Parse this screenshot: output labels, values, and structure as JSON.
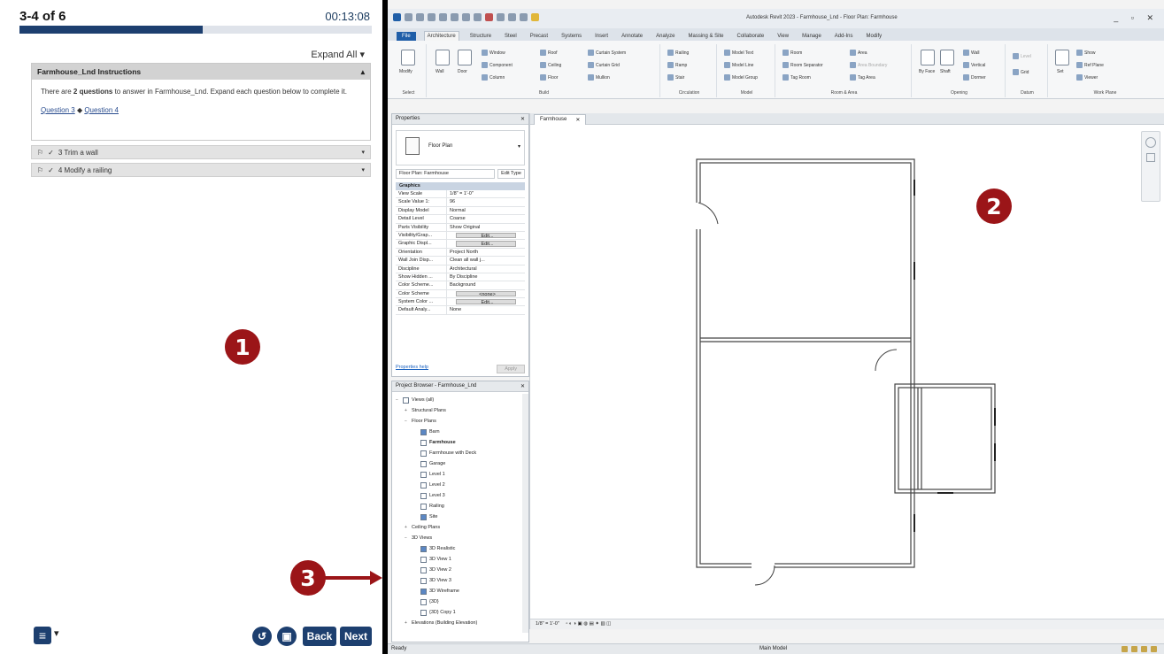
{
  "exam": {
    "question_count": "3-4 of 6",
    "timer": "00:13:08",
    "progress_fraction": 0.52,
    "expand_all": "Expand All",
    "instructions_title": "Farmhouse_Lnd Instructions",
    "instructions_body_pre": "There are ",
    "instructions_body_bold": "2 questions",
    "instructions_body_post": " to answer in Farmhouse_Lnd. Expand each question below to complete it.",
    "link_q3": "Question 3",
    "link_q4": "Question 4",
    "questions": [
      {
        "label": "3 Trim a wall"
      },
      {
        "label": "4 Modify a railing"
      }
    ],
    "back_label": "Back",
    "next_label": "Next",
    "markers": [
      "1",
      "2",
      "3"
    ],
    "marker_color": "#9b1518",
    "accent": "#1d3f6f"
  },
  "revit": {
    "title": "Autodesk Revit 2023 - Farmhouse_Lnd - Floor Plan: Farmhouse",
    "tabs": [
      "File",
      "Architecture",
      "Structure",
      "Steel",
      "Precast",
      "Systems",
      "Insert",
      "Annotate",
      "Analyze",
      "Massing & Site",
      "Collaborate",
      "View",
      "Manage",
      "Add-Ins",
      "Modify"
    ],
    "ribbon_groups": [
      {
        "label": "Select",
        "items": [
          "Modify"
        ]
      },
      {
        "label": "Build",
        "items": [
          "Wall",
          "Door",
          "Window",
          "Component",
          "Column",
          "Roof",
          "Ceiling",
          "Floor",
          "Curtain System",
          "Curtain Grid",
          "Mullion"
        ]
      },
      {
        "label": "Circulation",
        "items": [
          "Railing",
          "Ramp",
          "Stair"
        ]
      },
      {
        "label": "Model",
        "items": [
          "Model Text",
          "Model Line",
          "Model Group"
        ]
      },
      {
        "label": "Room & Area",
        "items": [
          "Room",
          "Room Separator",
          "Tag Room",
          "Area",
          "Area Boundary",
          "Tag Area"
        ]
      },
      {
        "label": "Opening",
        "items": [
          "By Face",
          "Shaft",
          "Wall",
          "Vertical",
          "Dormer"
        ]
      },
      {
        "label": "Datum",
        "items": [
          "Level",
          "Grid"
        ]
      },
      {
        "label": "Work Plane",
        "items": [
          "Set",
          "Show",
          "Ref Plane",
          "Viewer"
        ]
      }
    ],
    "properties": {
      "title": "Properties",
      "type": "Floor Plan",
      "instance": "Floor Plan: Farmhouse",
      "edit_type": "Edit Type",
      "section": "Graphics",
      "rows": [
        {
          "k": "View Scale",
          "v": "1/8\" = 1'-0\""
        },
        {
          "k": "Scale Value 1:",
          "v": "96"
        },
        {
          "k": "Display Model",
          "v": "Normal"
        },
        {
          "k": "Detail Level",
          "v": "Coarse"
        },
        {
          "k": "Parts Visibility",
          "v": "Show Original"
        },
        {
          "k": "Visibility/Grap...",
          "v": "Edit..."
        },
        {
          "k": "Graphic Displ...",
          "v": "Edit..."
        },
        {
          "k": "Orientation",
          "v": "Project North"
        },
        {
          "k": "Wall Join Disp...",
          "v": "Clean all wall j..."
        },
        {
          "k": "Discipline",
          "v": "Architectural"
        },
        {
          "k": "Show Hidden ...",
          "v": "By Discipline"
        },
        {
          "k": "Color Scheme...",
          "v": "Background"
        },
        {
          "k": "Color Scheme",
          "v": "<none>"
        },
        {
          "k": "System Color ...",
          "v": "Edit..."
        },
        {
          "k": "Default Analy...",
          "v": "None"
        }
      ],
      "help_link": "Properties help",
      "apply": "Apply"
    },
    "browser": {
      "title": "Project Browser - Farmhouse_Lnd",
      "nodes": [
        {
          "label": "Views (all)",
          "depth": 0,
          "toggle": "−",
          "box": true,
          "checked": false
        },
        {
          "label": "Structural Plans",
          "depth": 1,
          "toggle": "+",
          "box": false,
          "checked": false
        },
        {
          "label": "Floor Plans",
          "depth": 1,
          "toggle": "−",
          "box": false,
          "checked": false
        },
        {
          "label": "Barn",
          "depth": 2,
          "toggle": "",
          "box": true,
          "checked": true
        },
        {
          "label": "Farmhouse",
          "depth": 2,
          "toggle": "",
          "box": true,
          "checked": false,
          "bold": true
        },
        {
          "label": "Farmhouse with Deck",
          "depth": 2,
          "toggle": "",
          "box": true,
          "checked": false
        },
        {
          "label": "Garage",
          "depth": 2,
          "toggle": "",
          "box": true,
          "checked": false
        },
        {
          "label": "Level 1",
          "depth": 2,
          "toggle": "",
          "box": true,
          "checked": false
        },
        {
          "label": "Level 2",
          "depth": 2,
          "toggle": "",
          "box": true,
          "checked": false
        },
        {
          "label": "Level 3",
          "depth": 2,
          "toggle": "",
          "box": true,
          "checked": false
        },
        {
          "label": "Railing",
          "depth": 2,
          "toggle": "",
          "box": true,
          "checked": false
        },
        {
          "label": "Site",
          "depth": 2,
          "toggle": "",
          "box": true,
          "checked": true
        },
        {
          "label": "Ceiling Plans",
          "depth": 1,
          "toggle": "+",
          "box": false,
          "checked": false
        },
        {
          "label": "3D Views",
          "depth": 1,
          "toggle": "−",
          "box": false,
          "checked": false
        },
        {
          "label": "3D Realistic",
          "depth": 2,
          "toggle": "",
          "box": true,
          "checked": true
        },
        {
          "label": "3D View 1",
          "depth": 2,
          "toggle": "",
          "box": true,
          "checked": false
        },
        {
          "label": "3D View 2",
          "depth": 2,
          "toggle": "",
          "box": true,
          "checked": false
        },
        {
          "label": "3D View 3",
          "depth": 2,
          "toggle": "",
          "box": true,
          "checked": false
        },
        {
          "label": "3D Wireframe",
          "depth": 2,
          "toggle": "",
          "box": true,
          "checked": true
        },
        {
          "label": "{3D}",
          "depth": 2,
          "toggle": "",
          "box": true,
          "checked": false
        },
        {
          "label": "{3D} Copy 1",
          "depth": 2,
          "toggle": "",
          "box": true,
          "checked": false
        },
        {
          "label": "Elevations (Building Elevation)",
          "depth": 1,
          "toggle": "+",
          "box": false,
          "checked": false
        }
      ]
    },
    "view_tab": "Farmhouse",
    "view_scale": "1/8\" = 1'-0\"",
    "status_left": "Ready",
    "status_filter": "Main Model"
  }
}
